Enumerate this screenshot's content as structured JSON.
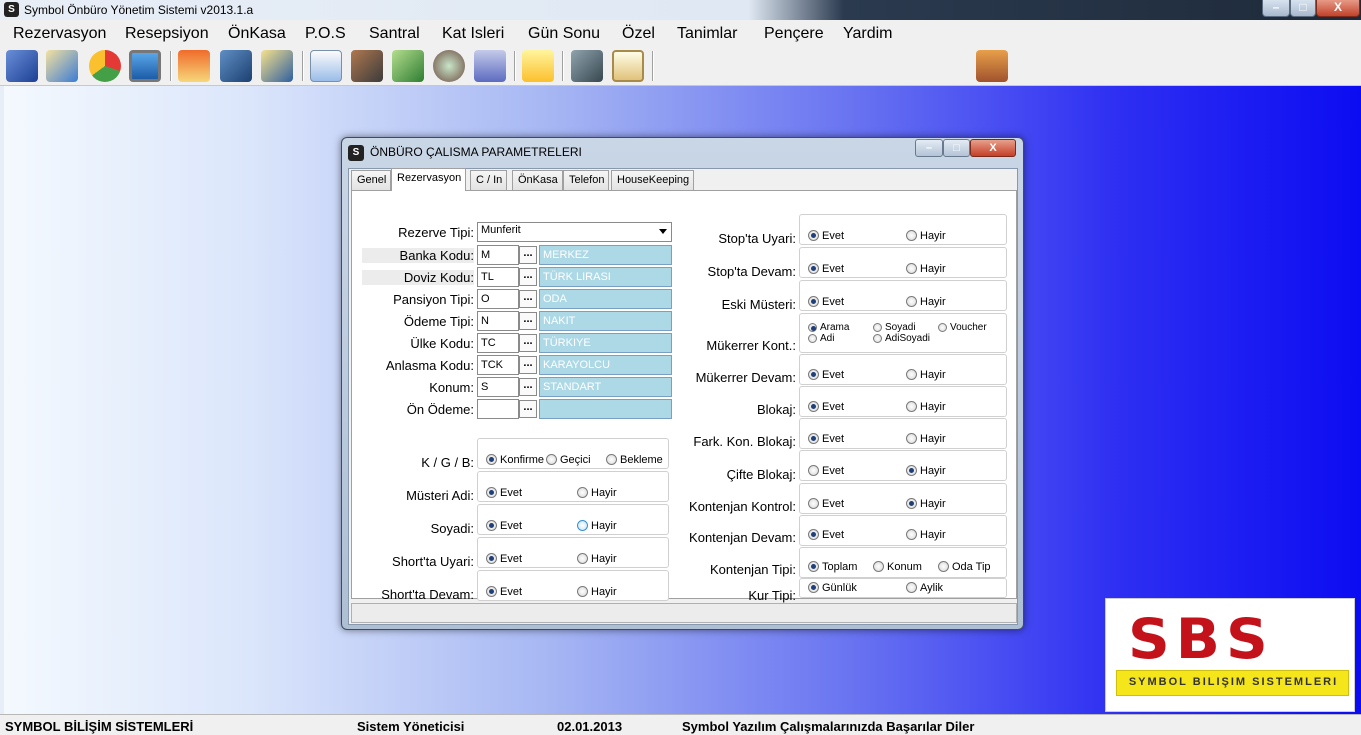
{
  "app": {
    "title": "Symbol Önbüro Yönetim Sistemi v2013.1.a",
    "icon": "S"
  },
  "window_controls": {
    "minimize": "–",
    "maximize": "□",
    "close": "X"
  },
  "menu": [
    "Rezervasyon",
    "Resepsiyon",
    "ÖnKasa",
    "P.O.S",
    "Santral",
    "Kat Isleri",
    "Gün Sonu",
    "Özel",
    "Tanimlar",
    "Pençere",
    "Yardim"
  ],
  "toolbar_icons": [
    "edit-icon",
    "checklist-icon",
    "pie-chart-icon",
    "monitor-icon",
    "home-icon",
    "satellite-icon",
    "pencil-note-icon",
    "document-icon",
    "person-search-icon",
    "money-icon",
    "globe-icon",
    "calculator-icon",
    "sticky-note-icon",
    "server-icon",
    "notepad-icon",
    "exit-icon"
  ],
  "dialog": {
    "title": "ÖNBÜRO ÇALISMA PARAMETRELERI",
    "tabs": [
      "Genel",
      "Rezervasyon",
      "C / In",
      "ÖnKasa",
      "Telefon",
      "HouseKeeping"
    ],
    "active_tab": "Rezervasyon",
    "rezerve_tipi": {
      "label": "Rezerve Tipi:",
      "value": "Munferit"
    },
    "code_fields": [
      {
        "label": "Banka Kodu:",
        "code": "M",
        "desc": "MERKEZ"
      },
      {
        "label": "Doviz Kodu:",
        "code": "TL",
        "desc": "TÜRK LIRASI"
      },
      {
        "label": "Pansiyon Tipi:",
        "code": "O",
        "desc": "ODA"
      },
      {
        "label": "Ödeme Tipi:",
        "code": "N",
        "desc": "NAKIT"
      },
      {
        "label": "Ülke Kodu:",
        "code": "TC",
        "desc": "TÜRKIYE"
      },
      {
        "label": "Anlasma Kodu:",
        "code": "TCK",
        "desc": "KARAYOLCU"
      },
      {
        "label": "Konum:",
        "code": "S",
        "desc": "STANDART"
      },
      {
        "label": "Ön Ödeme:",
        "code": "",
        "desc": ""
      }
    ],
    "dots_label": "...",
    "left_groups": [
      {
        "label": "K / G / B:",
        "options": [
          "Konfirme",
          "Geçici",
          "Bekleme"
        ],
        "selected": 0
      },
      {
        "label": "Müsteri Adi:",
        "options": [
          "Evet",
          "Hayir"
        ],
        "selected": 0
      },
      {
        "label": "Soyadi:",
        "options": [
          "Evet",
          "Hayir"
        ],
        "selected": 0
      },
      {
        "label": "Short'ta Uyari:",
        "options": [
          "Evet",
          "Hayir"
        ],
        "selected": 0
      },
      {
        "label": "Short'ta Devam:",
        "options": [
          "Evet",
          "Hayir"
        ],
        "selected": 0
      }
    ],
    "right_groups": [
      {
        "label": "Stop'ta Uyari:",
        "options": [
          "Evet",
          "Hayir"
        ],
        "selected": 0
      },
      {
        "label": "Stop'ta Devam:",
        "options": [
          "Evet",
          "Hayir"
        ],
        "selected": 0
      },
      {
        "label": "Eski Müsteri:",
        "options": [
          "Evet",
          "Hayir"
        ],
        "selected": 0
      },
      {
        "label": "Mükerrer Kont.:",
        "options": [
          "Arama",
          "Soyadi",
          "Voucher",
          "Adi",
          "AdiSoyadi"
        ],
        "selected": 0
      },
      {
        "label": "Mükerrer Devam:",
        "options": [
          "Evet",
          "Hayir"
        ],
        "selected": 0
      },
      {
        "label": "Blokaj:",
        "options": [
          "Evet",
          "Hayir"
        ],
        "selected": 0
      },
      {
        "label": "Fark. Kon. Blokaj:",
        "options": [
          "Evet",
          "Hayir"
        ],
        "selected": 0
      },
      {
        "label": "Çifte Blokaj:",
        "options": [
          "Evet",
          "Hayir"
        ],
        "selected": 1
      },
      {
        "label": "Kontenjan Kontrol:",
        "options": [
          "Evet",
          "Hayir"
        ],
        "selected": 1
      },
      {
        "label": "Kontenjan Devam:",
        "options": [
          "Evet",
          "Hayir"
        ],
        "selected": 0
      },
      {
        "label": "Kontenjan Tipi:",
        "options": [
          "Toplam",
          "Konum",
          "Oda Tip"
        ],
        "selected": 0
      },
      {
        "label": "Kur Tipi:",
        "options": [
          "Günlük",
          "Aylik"
        ],
        "selected": 0
      }
    ]
  },
  "logo": {
    "main": "SBS",
    "sub": "SYMBOL BILIŞIM SISTEMLERI"
  },
  "statusbar": {
    "company": "SYMBOL BİLİŞİM SİSTEMLERİ",
    "user": "Sistem Yöneticisi",
    "date": "02.01.2013",
    "message": "Symbol Yazılım Çalışmalarınızda Başarılar Diler"
  },
  "colors": {
    "desktop_gradient_end": "#0c0cf2",
    "field_desc_bg": "#add8e6",
    "logo_red": "#c3121a",
    "logo_yellow": "#f5e61c"
  }
}
